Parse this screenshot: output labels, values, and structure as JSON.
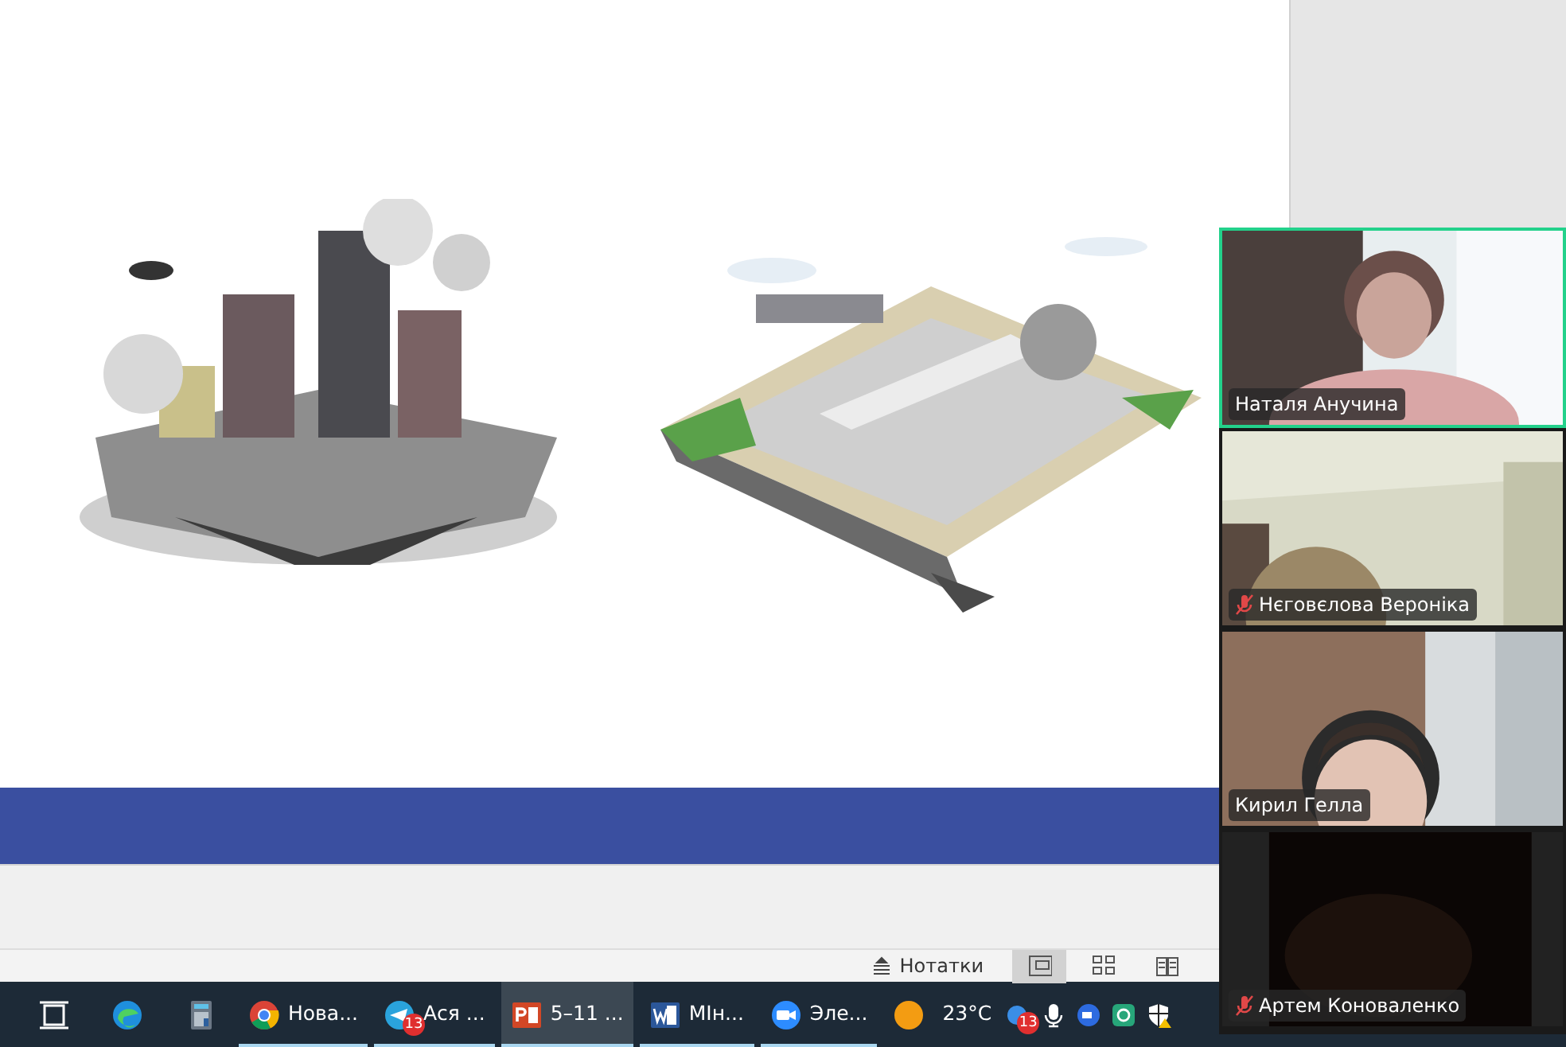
{
  "status_bar": {
    "notes_label": "Нотатки",
    "views": [
      {
        "kind": "normal",
        "selected": true
      },
      {
        "kind": "sorter",
        "selected": false
      },
      {
        "kind": "reading",
        "selected": false
      }
    ]
  },
  "taskbar": {
    "apps": [
      {
        "kind": "taskview",
        "running": false,
        "active": false
      },
      {
        "kind": "edge",
        "running": false,
        "active": false
      },
      {
        "kind": "calculator",
        "running": false,
        "active": false
      },
      {
        "kind": "chrome",
        "label": "Нова...",
        "running": true,
        "active": false
      },
      {
        "kind": "telegram",
        "label": "Ася ...",
        "badge": "13",
        "running": true,
        "active": false
      },
      {
        "kind": "powerpoint",
        "label": "5–11 ...",
        "running": true,
        "active": true
      },
      {
        "kind": "word",
        "label": "МІн...",
        "running": true,
        "active": false
      },
      {
        "kind": "zoom",
        "label": "Эле...",
        "running": true,
        "active": false
      }
    ],
    "weather": "23°C",
    "tray": [
      {
        "kind": "mail",
        "badge": "13"
      },
      {
        "kind": "microphone"
      },
      {
        "kind": "zoom"
      },
      {
        "kind": "sync"
      },
      {
        "kind": "shield"
      }
    ]
  },
  "participants": [
    {
      "name": "Наталя Анучина",
      "muted": false,
      "speaking": true
    },
    {
      "name": "Нєговєлова Вероніка",
      "muted": true,
      "speaking": false
    },
    {
      "name": "Кирил Гелла",
      "muted": false,
      "speaking": false
    },
    {
      "name": "Артем Коноваленко",
      "muted": true,
      "speaking": false
    }
  ]
}
